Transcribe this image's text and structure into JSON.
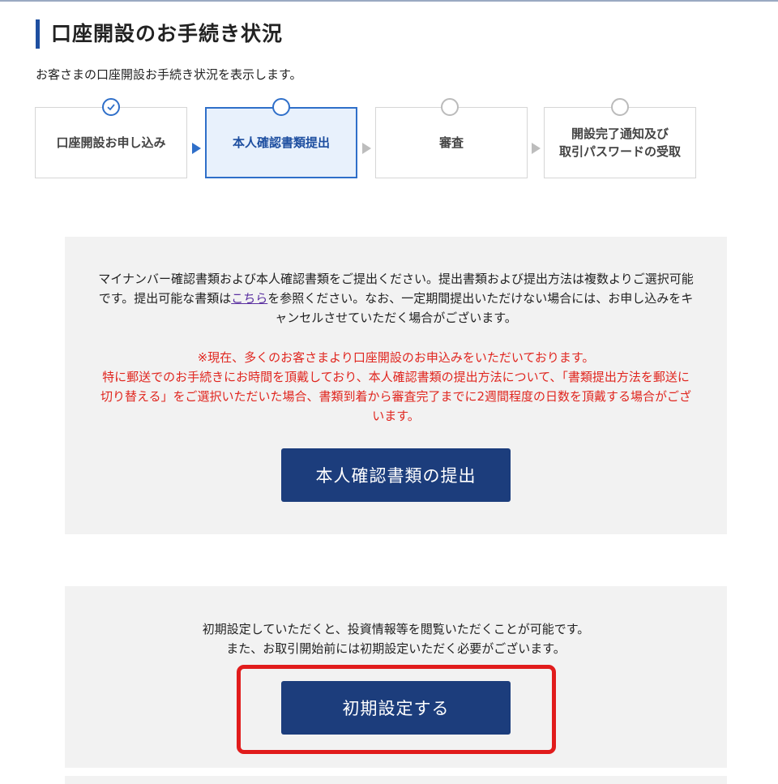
{
  "header": {
    "title": "口座開設のお手続き状況",
    "description": "お客さまの口座開設お手続き状況を表示します。"
  },
  "steps": [
    {
      "label_line1": "口座開設お申し込み",
      "label_line2": "",
      "status": "done"
    },
    {
      "label_line1": "本人確認書類提出",
      "label_line2": "",
      "status": "current"
    },
    {
      "label_line1": "審査",
      "label_line2": "",
      "status": "pending"
    },
    {
      "label_line1": "開設完了通知及び",
      "label_line2": "取引パスワードの受取",
      "status": "pending"
    }
  ],
  "document_panel": {
    "intro_before_link": "マイナンバー確認書類および本人確認書類をご提出ください。提出書類および提出方法は複数よりご選択可能です。提出可能な書類は",
    "link_text": "こちら",
    "intro_after_link": "を参照ください。なお、一定期間提出いただけない場合には、お申し込みをキャンセルさせていただく場合がございます。",
    "notice_line1": "※現在、多くのお客さまより口座開設のお申込みをいただいております。",
    "notice_line2": "特に郵送でのお手続きにお時間を頂戴しており、本人確認書類の提出方法について、「書類提出方法を郵送に切り替える」をご選択いただいた場合、書類到着から審査完了までに2週間程度の日数を頂戴する場合がございます。",
    "button_label": "本人確認書類の提出"
  },
  "settings_panel": {
    "line1": "初期設定していただくと、投資情報等を閲覧いただくことが可能です。",
    "line2": "また、お取引開始前には初期設定いただく必要がございます。",
    "button_label": "初期設定する"
  },
  "colors": {
    "accent": "#1e4fa0",
    "button": "#1c3d7c",
    "notice": "#e0261f",
    "highlight": "#e11c1c",
    "panel_bg": "#f2f2f2"
  }
}
